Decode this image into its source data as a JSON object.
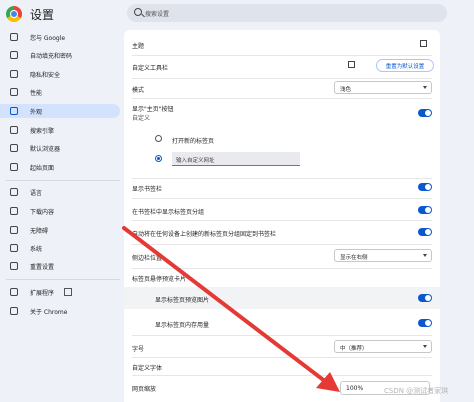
{
  "header": {
    "title": "设置",
    "search_placeholder": "搜索设置"
  },
  "sidebar": {
    "items": [
      {
        "label": "您与 Google",
        "icon": "google-icon"
      },
      {
        "label": "自动填充和密码",
        "icon": "autofill-icon"
      },
      {
        "label": "隐私和安全",
        "icon": "shield-icon"
      },
      {
        "label": "性能",
        "icon": "speedometer-icon"
      },
      {
        "label": "外观",
        "icon": "palette-icon"
      },
      {
        "label": "搜索引擎",
        "icon": "search-icon"
      },
      {
        "label": "默认浏览器",
        "icon": "browser-icon"
      },
      {
        "label": "起始页面",
        "icon": "power-icon"
      },
      {
        "label": "语言",
        "icon": "language-icon"
      },
      {
        "label": "下载内容",
        "icon": "download-icon"
      },
      {
        "label": "无障碍",
        "icon": "accessibility-icon"
      },
      {
        "label": "系统",
        "icon": "wrench-icon"
      },
      {
        "label": "重置设置",
        "icon": "reset-icon"
      },
      {
        "label": "扩展程序",
        "icon": "puzzle-icon"
      },
      {
        "label": "关于 Chrome",
        "icon": "chrome-icon"
      }
    ],
    "active_index": 4
  },
  "panel": {
    "theme_label": "主题",
    "toolbar_label": "自定义工具栏",
    "reset_default_label": "重置为默认设置",
    "mode_label": "模式",
    "mode_value": "浅色",
    "home_label": "显示\"主页\"按钮",
    "home_sub": "自定义",
    "radio_new_tab": "打开新的标签页",
    "url_placeholder": "输入自定义网址",
    "bookmarks_bar": "显示书签栏",
    "tab_groups_bar": "在书签栏中显示标签页分组",
    "saved_groups_bar": "自动将在任何设备上创建的新标签页分组固定到书签栏",
    "side_panel_label": "侧边栏位置",
    "side_panel_value": "显示在右侧",
    "hover_card_label": "标签页悬停预览卡片",
    "hover_image": "显示标签页预览图片",
    "hover_memory": "显示标签页内存用量",
    "font_size_label": "字号",
    "font_size_value": "中（推荐）",
    "custom_fonts": "自定义字体",
    "zoom_label": "网页缩放",
    "zoom_value": "100%"
  },
  "watermark": "CSDN @测试者家琪",
  "colors": {
    "accent": "#0b57d0",
    "arrow": "#e53935",
    "background": "#eef1f8"
  }
}
